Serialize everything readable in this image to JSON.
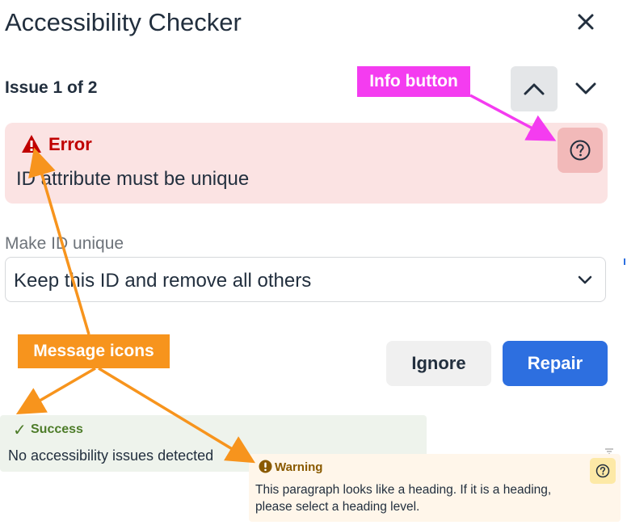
{
  "dialog": {
    "title": "Accessibility Checker",
    "issue_count": "Issue 1 of 2",
    "icons": {
      "close": "close-icon",
      "previous": "chevron-up-icon",
      "next": "chevron-down-icon"
    }
  },
  "error": {
    "severity_label": "Error",
    "message": "ID attribute must be unique",
    "icon": "warning-triangle-icon",
    "info_icon": "help-circle-icon"
  },
  "repair": {
    "field_label": "Make ID unique",
    "selected_option": "Keep this ID and remove all others",
    "ignore_label": "Ignore",
    "repair_label": "Repair"
  },
  "notifications": {
    "success": {
      "label": "Success",
      "message": "No accessibility issues detected"
    },
    "warning": {
      "label": "Warning",
      "line1": "This paragraph looks like a heading. If it is a heading,",
      "line2": "please select a heading level."
    }
  },
  "annotations": {
    "info_button": "Info button",
    "message_icons": "Message icons"
  },
  "colors": {
    "error_bg": "#fbe3e3",
    "error_text": "#c00000",
    "primary": "#2d6fe0",
    "success_text": "#4d7c29",
    "warning_bg": "#fff6ea",
    "callout_magenta": "#f43cf0",
    "callout_orange": "#f7941d"
  }
}
